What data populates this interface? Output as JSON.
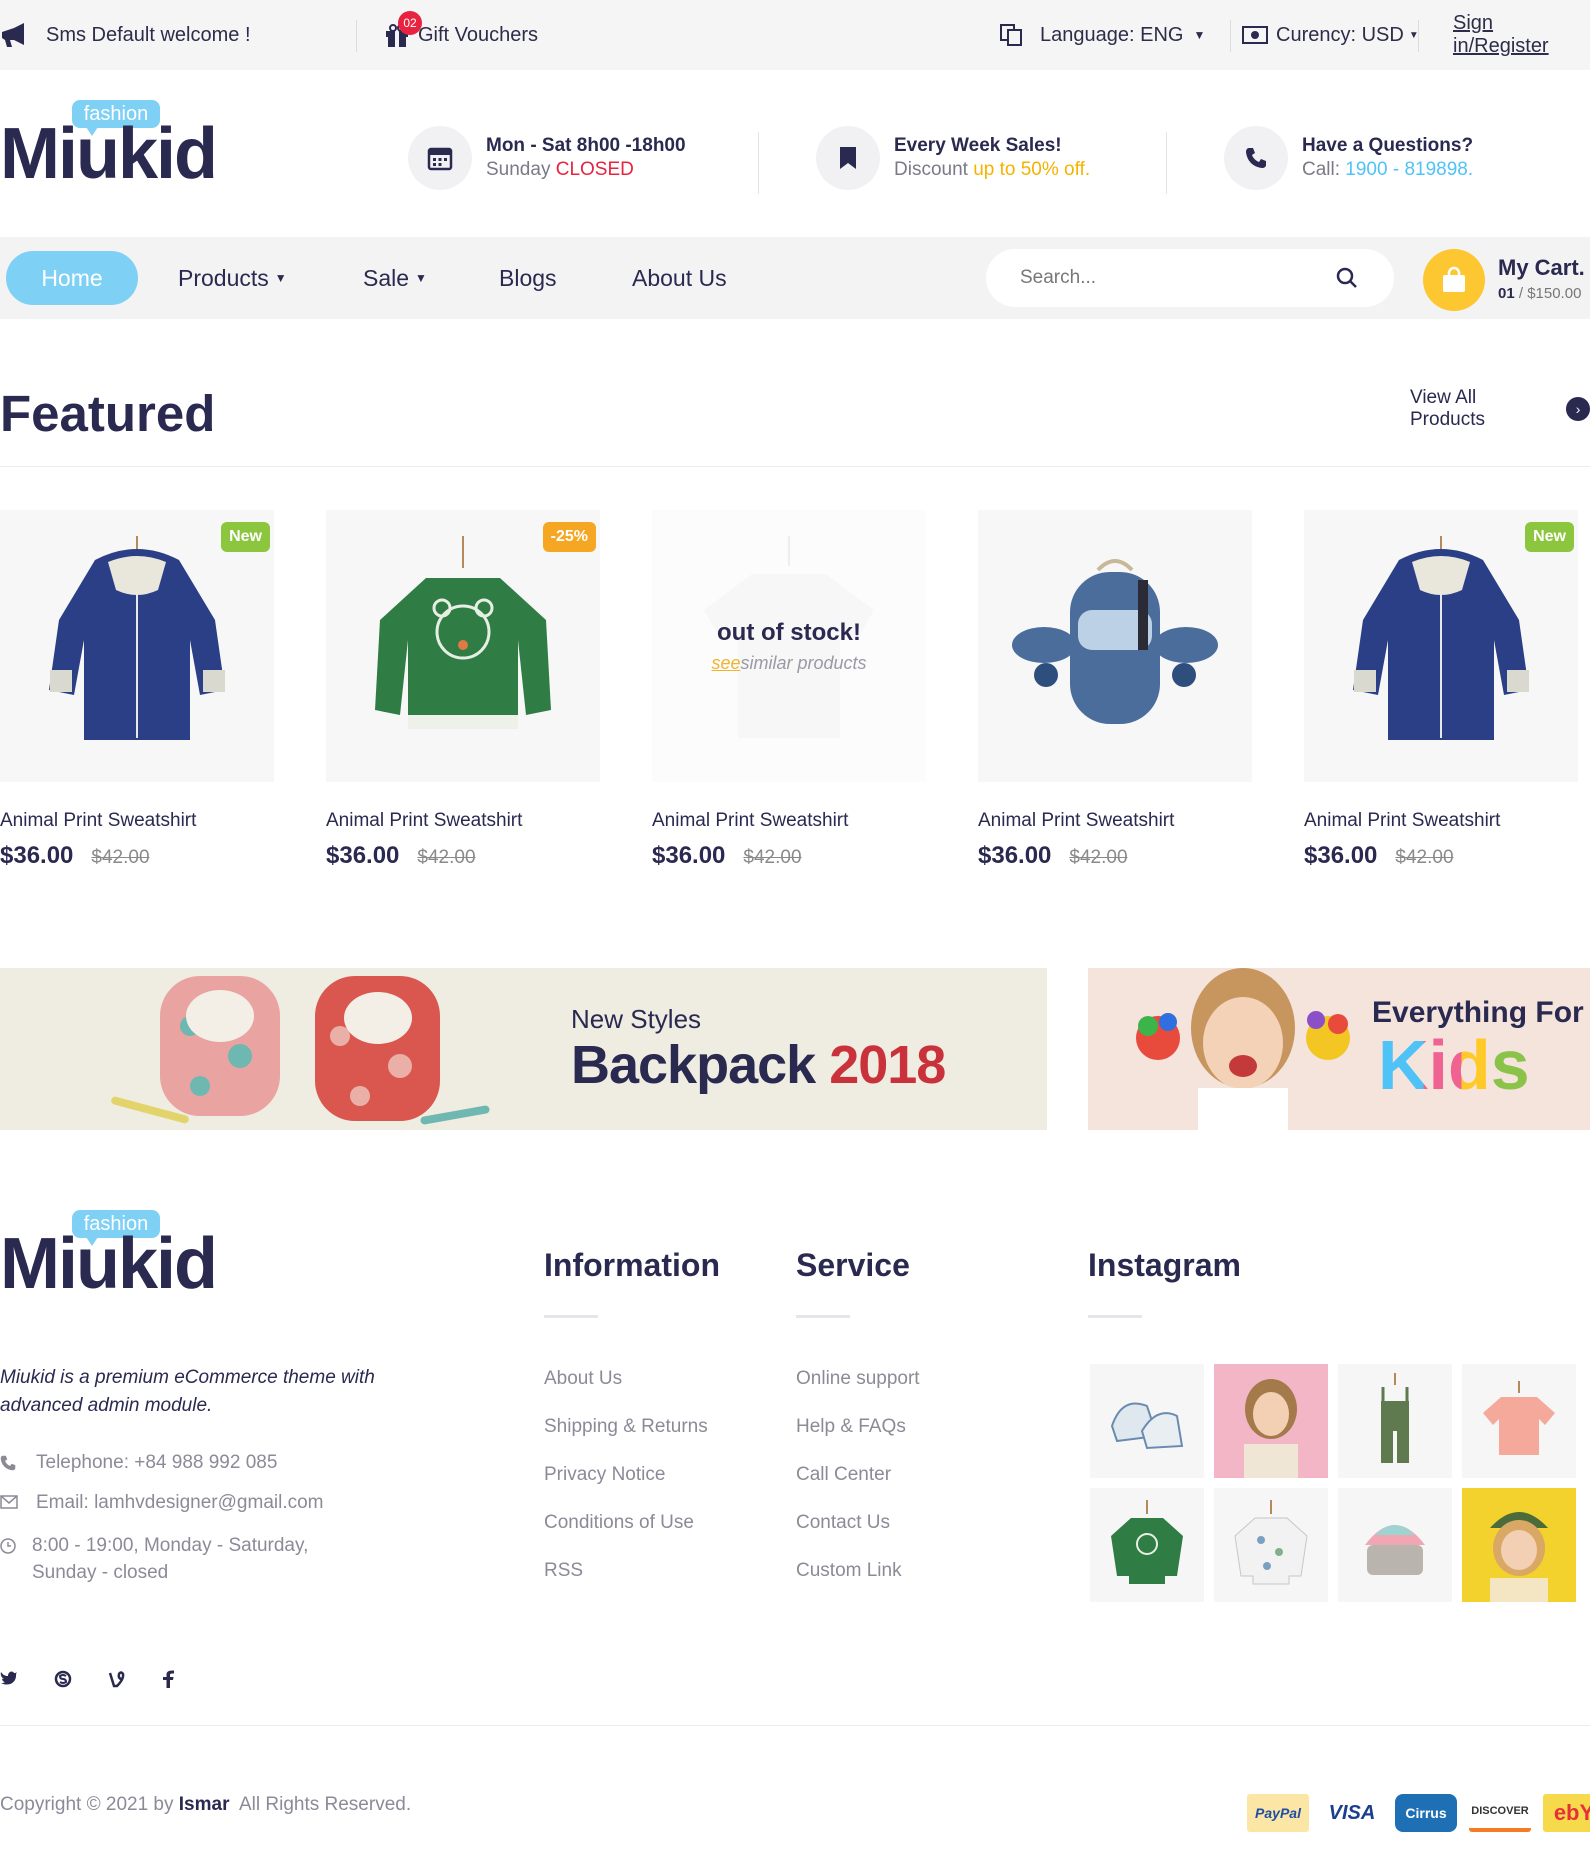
{
  "topbar": {
    "welcome": "Sms Default welcome !",
    "gift_badge": "02",
    "gift": "Gift Vouchers",
    "language": "Language: ENG",
    "currency": "Curency: USD",
    "signin": "Sign in/Register"
  },
  "logo": {
    "tag": "fashion",
    "word": "Miukid"
  },
  "header_info": [
    {
      "line1": "Mon - Sat 8h00 -18h00",
      "line2_prefix": "Sunday ",
      "line2_highlight": "CLOSED"
    },
    {
      "line1": "Every Week Sales!",
      "line2_prefix": "Discount ",
      "line2_highlight": "up to 50% off."
    },
    {
      "line1": "Have a Questions?",
      "line2_prefix": "Call: ",
      "line2_highlight": "1900 - 819898."
    }
  ],
  "nav": {
    "home": "Home",
    "products": "Products",
    "sale": "Sale",
    "blogs": "Blogs",
    "about": "About Us",
    "search_placeholder": "Search...",
    "cart_title": "My Cart.",
    "cart_count": "01",
    "cart_total": " / $150.00"
  },
  "featured": {
    "title": "Featured",
    "view_all": "View All Products",
    "products": [
      {
        "name": "Animal Print Sweatshirt",
        "price": "$36.00",
        "old_price": "$42.00",
        "tag": "New"
      },
      {
        "name": "Animal Print Sweatshirt",
        "price": "$36.00",
        "old_price": "$42.00",
        "tag": "-25%"
      },
      {
        "name": "Animal Print Sweatshirt",
        "price": "$36.00",
        "old_price": "$42.00",
        "oos_title": "out of stock!",
        "oos_see": "see",
        "oos_rest": "similar products"
      },
      {
        "name": "Animal Print Sweatshirt",
        "price": "$36.00",
        "old_price": "$42.00"
      },
      {
        "name": "Animal Print Sweatshirt",
        "price": "$36.00",
        "old_price": "$42.00",
        "tag": "New"
      }
    ]
  },
  "banners": {
    "b1_sub": "New Styles",
    "b1_main": "Backpack",
    "b1_year": "2018",
    "b2_sub": "Everything For",
    "b2_main": "Kids"
  },
  "footer": {
    "description": "Miukid is a premium eCommerce theme with advanced admin module.",
    "telephone": "Telephone: +84 988 992 085",
    "email": "Email: lamhvdesigner@gmail.com",
    "hours": "8:00 - 19:00, Monday - Saturday, Sunday - closed",
    "information_title": "Information",
    "information": [
      "About Us",
      "Shipping & Returns",
      "Privacy Notice",
      "Conditions of Use",
      "RSS"
    ],
    "service_title": "Service",
    "service": [
      "Online support",
      "Help & FAQs",
      "Call Center",
      "Contact Us",
      "Custom Link"
    ],
    "instagram_title": "Instagram",
    "copyright_prefix": "Copyright © 2021 by ",
    "copyright_brand": "Ismar",
    "copyright_suffix": "  All Rights Reserved.",
    "payments": [
      "PayPal",
      "VISA",
      "Cirrus",
      "DISCOVER",
      "ebY"
    ]
  },
  "colors": {
    "accent_blue": "#7fd0f5",
    "navy": "#2a2950",
    "cart_yellow": "#fdc731",
    "new_tag": "#8cc63f",
    "sale_tag": "#f5a623",
    "closed_red": "#e8233f",
    "discount_yellow": "#f5b300",
    "phone_blue": "#4fc3f7"
  }
}
